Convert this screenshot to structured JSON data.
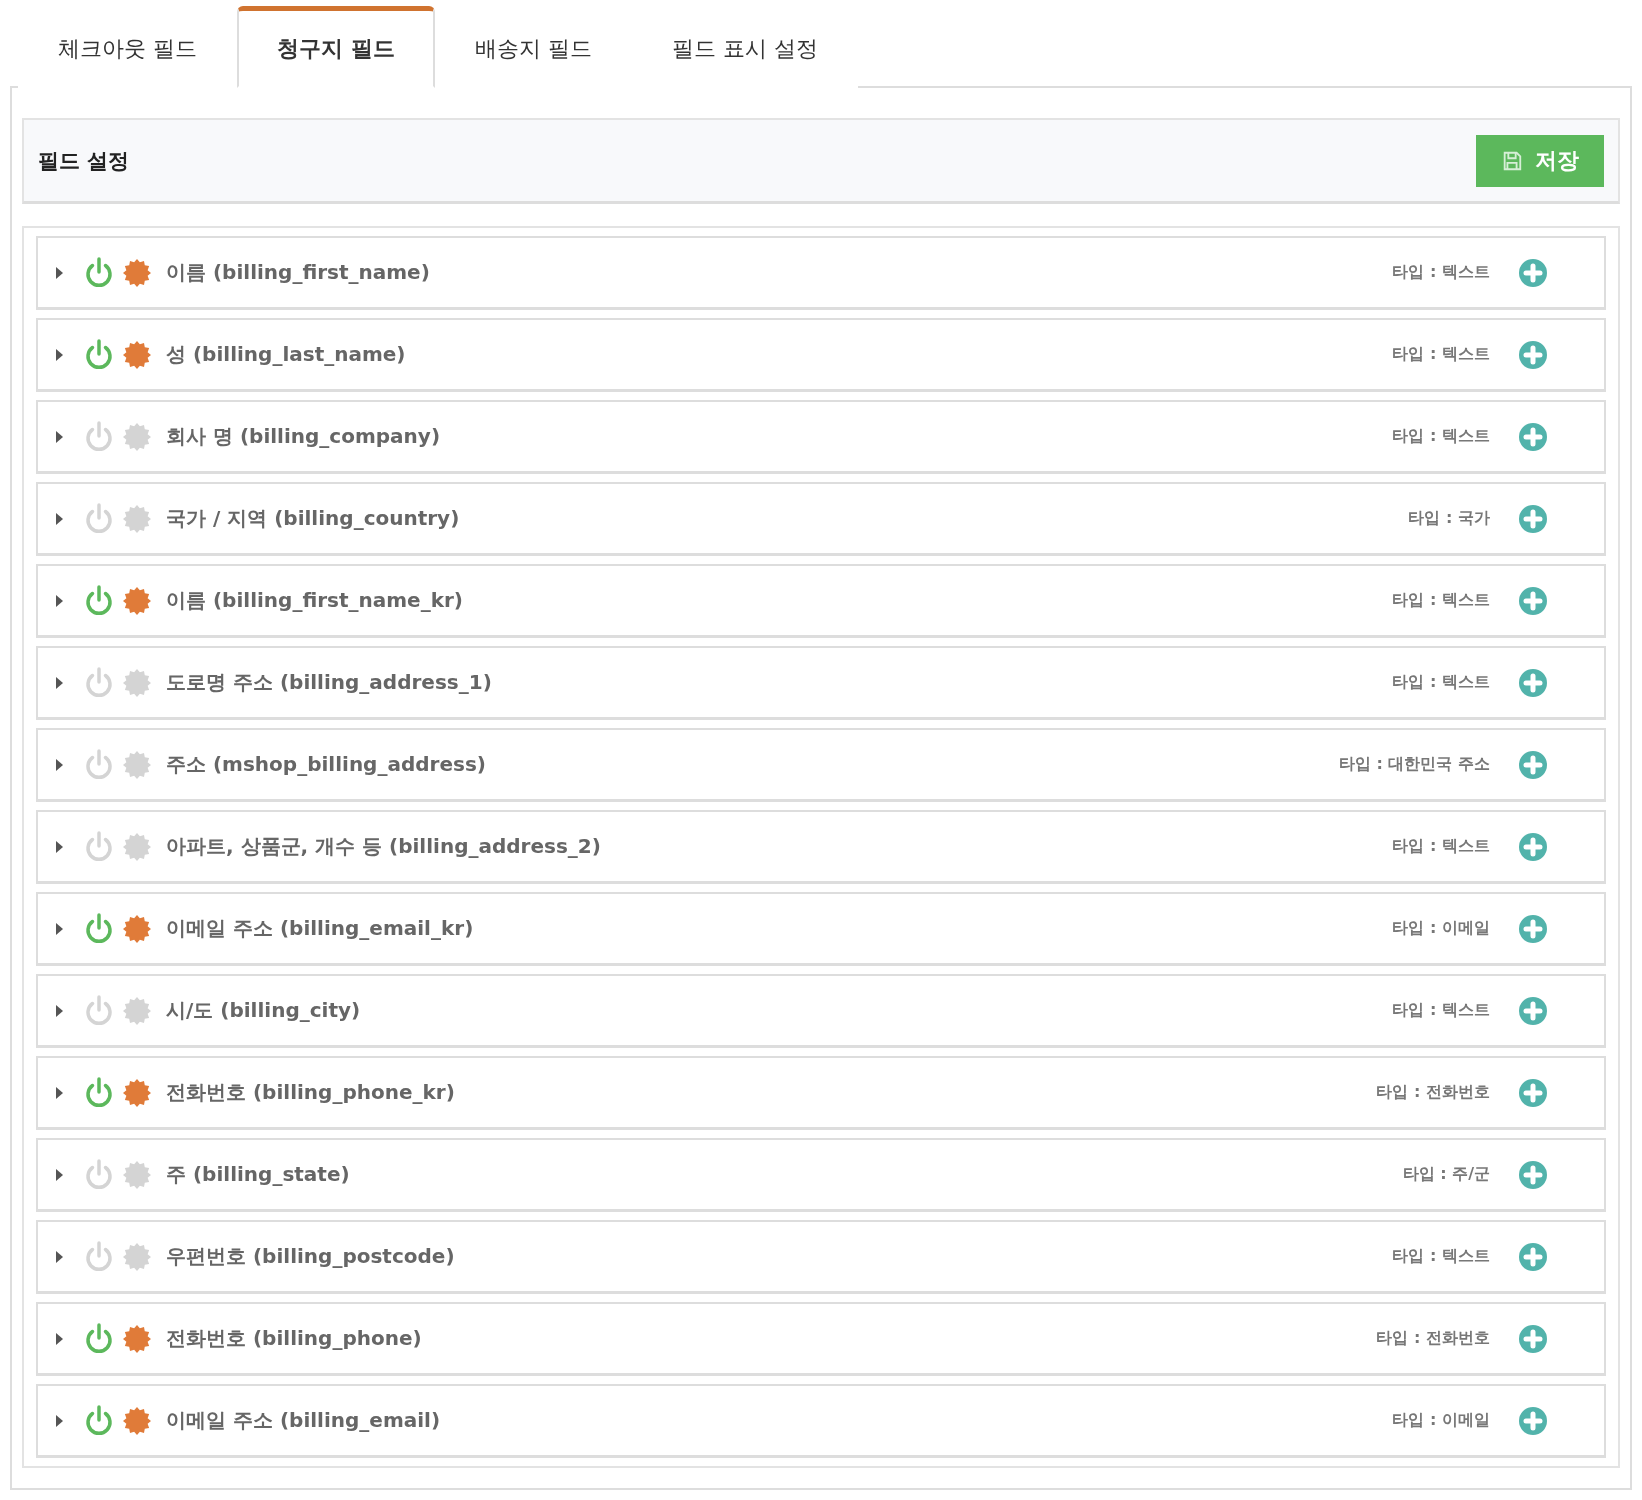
{
  "tabs": [
    {
      "label": "체크아웃 필드",
      "selected": false
    },
    {
      "label": "청구지 필드",
      "selected": true
    },
    {
      "label": "배송지 필드",
      "selected": false
    },
    {
      "label": "필드 표시 설정",
      "selected": false
    }
  ],
  "panel": {
    "title": "필드 설정",
    "save_button": "저장"
  },
  "fields": [
    {
      "label": "이름 (billing_first_name)",
      "type": "타입 : 텍스트",
      "enabled": true,
      "required": true
    },
    {
      "label": "성 (billing_last_name)",
      "type": "타입 : 텍스트",
      "enabled": true,
      "required": true
    },
    {
      "label": "회사 명 (billing_company)",
      "type": "타입 : 텍스트",
      "enabled": false,
      "required": false
    },
    {
      "label": "국가 / 지역 (billing_country)",
      "type": "타입 : 국가",
      "enabled": false,
      "required": false
    },
    {
      "label": "이름 (billing_first_name_kr)",
      "type": "타입 : 텍스트",
      "enabled": true,
      "required": true
    },
    {
      "label": "도로명 주소 (billing_address_1)",
      "type": "타입 : 텍스트",
      "enabled": false,
      "required": false
    },
    {
      "label": "주소 (mshop_billing_address)",
      "type": "타입 : 대한민국 주소",
      "enabled": false,
      "required": false
    },
    {
      "label": "아파트, 상품군, 개수 등 (billing_address_2)",
      "type": "타입 : 텍스트",
      "enabled": false,
      "required": false
    },
    {
      "label": "이메일 주소 (billing_email_kr)",
      "type": "타입 : 이메일",
      "enabled": true,
      "required": true
    },
    {
      "label": "시/도 (billing_city)",
      "type": "타입 : 텍스트",
      "enabled": false,
      "required": false
    },
    {
      "label": "전화번호 (billing_phone_kr)",
      "type": "타입 : 전화번호",
      "enabled": true,
      "required": true
    },
    {
      "label": "주 (billing_state)",
      "type": "타입 : 주/군",
      "enabled": false,
      "required": false
    },
    {
      "label": "우편번호 (billing_postcode)",
      "type": "타입 : 텍스트",
      "enabled": false,
      "required": false
    },
    {
      "label": "전화번호 (billing_phone)",
      "type": "타입 : 전화번호",
      "enabled": true,
      "required": true
    },
    {
      "label": "이메일 주소 (billing_email)",
      "type": "타입 : 이메일",
      "enabled": true,
      "required": true
    }
  ]
}
